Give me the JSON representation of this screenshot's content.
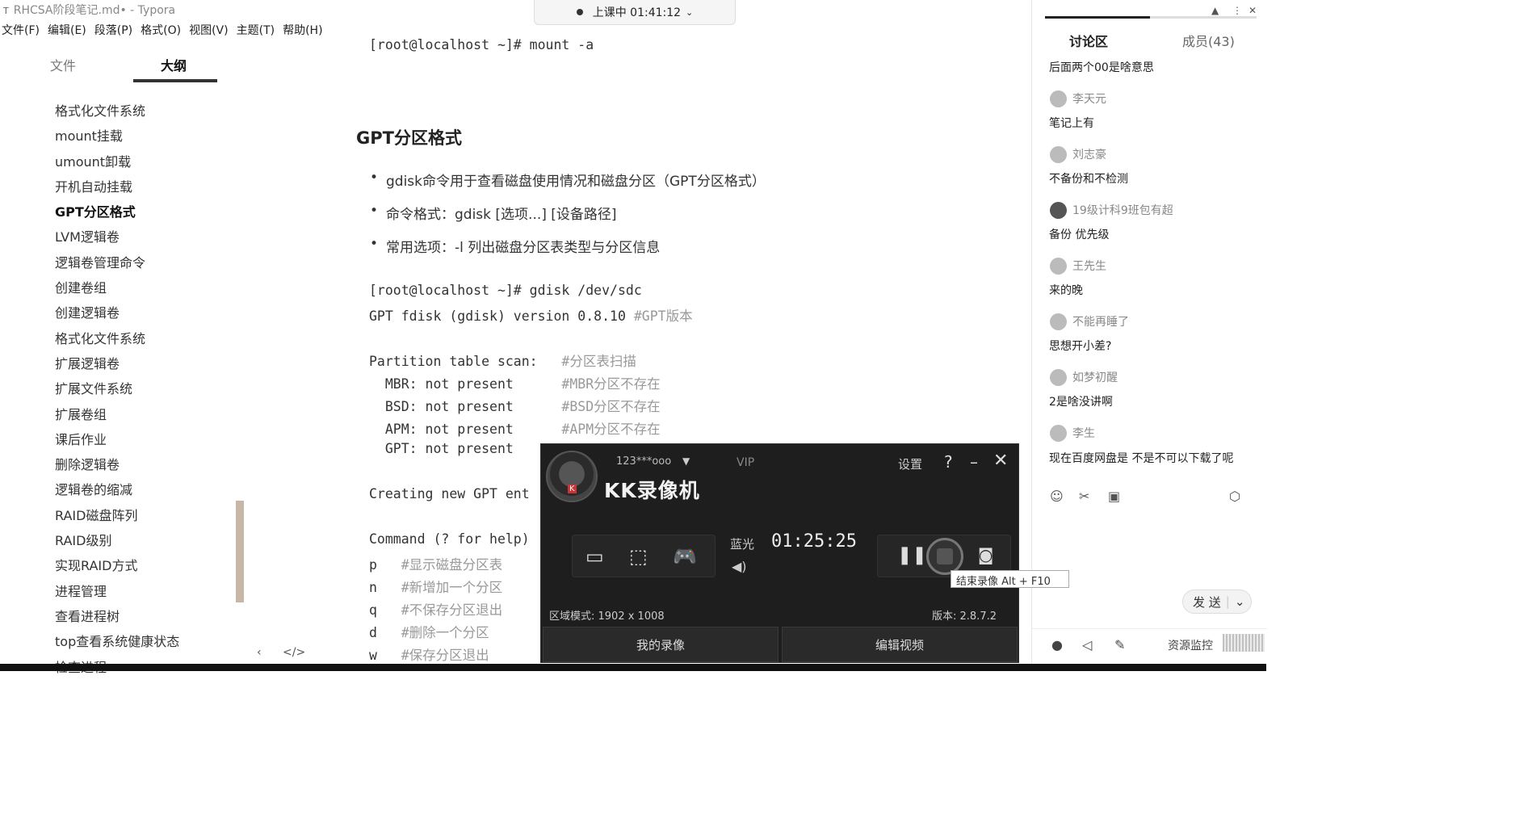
{
  "window": {
    "title": "RHCSA阶段笔记.md• - Typora"
  },
  "menu": [
    "文件(F)",
    "编辑(E)",
    "段落(P)",
    "格式(O)",
    "视图(V)",
    "主题(T)",
    "帮助(H)"
  ],
  "sidebar": {
    "tab_files": "文件",
    "tab_outline": "大纲",
    "items": [
      "格式化文件系统",
      "mount挂载",
      "umount卸载",
      "开机自动挂载",
      "GPT分区格式",
      "LVM逻辑卷",
      "逻辑卷管理命令",
      "创建卷组",
      "创建逻辑卷",
      "格式化文件系统",
      "扩展逻辑卷",
      "扩展文件系统",
      "扩展卷组",
      "课后作业",
      "删除逻辑卷",
      "逻辑卷的缩减",
      "RAID磁盘阵列",
      "RAID级别",
      "实现RAID方式",
      "进程管理",
      "查看进程树",
      "top查看系统健康状态",
      "检查进程"
    ],
    "active_index": 4,
    "footer_back": "‹",
    "footer_source": "</>"
  },
  "lesson": {
    "status": "上课中 01:41:12"
  },
  "editor": {
    "cmd_mount": "[root@localhost ~]# mount -a",
    "heading": "GPT分区格式",
    "bullets": [
      "gdisk命令用于查看磁盘使用情况和磁盘分区（GPT分区格式）",
      "命令格式：gdisk [选项...] [设备路径]",
      "常用选项：-l 列出磁盘分区表类型与分区信息"
    ],
    "lines": [
      {
        "text": "[root@localhost ~]# gdisk /dev/sdc",
        "comment": ""
      },
      {
        "text": "GPT fdisk (gdisk) version 0.8.10 ",
        "comment": "#GPT版本"
      },
      {
        "text": "",
        "comment": ""
      },
      {
        "text": "Partition table scan:   ",
        "comment": "#分区表扫描"
      },
      {
        "text": "  MBR: not present      ",
        "comment": "#MBR分区不存在"
      },
      {
        "text": "  BSD: not present      ",
        "comment": "#BSD分区不存在"
      },
      {
        "text": "  APM: not present      ",
        "comment": "#APM分区不存在"
      },
      {
        "text": "  GPT: not present",
        "comment": ""
      },
      {
        "text": "",
        "comment": ""
      },
      {
        "text": "Creating new GPT ent",
        "comment": ""
      },
      {
        "text": "",
        "comment": ""
      },
      {
        "text": "Command (? for help)",
        "comment": ""
      },
      {
        "text": "p   ",
        "comment": "#显示磁盘分区表"
      },
      {
        "text": "n   ",
        "comment": "#新增加一个分区"
      },
      {
        "text": "q   ",
        "comment": "#不保存分区退出"
      },
      {
        "text": "d   ",
        "comment": "#删除一个分区"
      },
      {
        "text": "w   ",
        "comment": "#保存分区退出"
      }
    ]
  },
  "chat": {
    "title": "讨论区",
    "members": "成员(43)",
    "first_text": "后面两个00是啥意思",
    "messages": [
      {
        "name": "李天元",
        "text": "笔记上有"
      },
      {
        "name": "刘志豪",
        "text": "不备份和不检测"
      },
      {
        "name": "19级计科9班包有超",
        "text": "备份  优先级"
      },
      {
        "name": "王先生",
        "text": "来的晚"
      },
      {
        "name": "不能再睡了",
        "text": "思想开小差?"
      },
      {
        "name": "如梦初醒",
        "text": "2是啥没讲啊"
      },
      {
        "name": "李生",
        "text": "现在百度网盘是 不是不可以下载了呢"
      }
    ],
    "send_label": "发 送",
    "resource_label": "资源监控"
  },
  "recorder": {
    "account": "123***ooo",
    "vip": "VIP",
    "settings": "设置",
    "help": "?",
    "title": "KK录像机",
    "quality": "蓝光",
    "time": "01:25:25",
    "tooltip": "结束录像 Alt + F10",
    "region": "区域模式: 1902 x 1008",
    "version": "版本: 2.8.7.2",
    "btn_my_recordings": "我的录像",
    "btn_edit_video": "编辑视频"
  }
}
